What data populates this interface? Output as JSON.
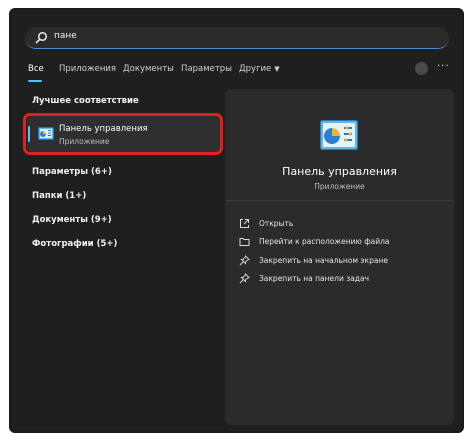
{
  "search": {
    "query": "пане"
  },
  "tabs": [
    {
      "label": "Все"
    },
    {
      "label": "Приложения"
    },
    {
      "label": "Документы"
    },
    {
      "label": "Параметры"
    },
    {
      "label": "Другие"
    }
  ],
  "left": {
    "best_match_title": "Лучшее соответствие",
    "best_match": {
      "name": "Панель управления",
      "type": "Приложение"
    },
    "categories": [
      {
        "label": "Параметры (6+)"
      },
      {
        "label": "Папки (1+)"
      },
      {
        "label": "Документы (9+)"
      },
      {
        "label": "Фотографии (5+)"
      }
    ]
  },
  "preview": {
    "title": "Панель управления",
    "type": "Приложение",
    "actions": [
      {
        "label": "Открыть",
        "icon": "open-icon"
      },
      {
        "label": "Перейти к расположению файла",
        "icon": "folder-icon"
      },
      {
        "label": "Закрепить на начальном экране",
        "icon": "pin-icon"
      },
      {
        "label": "Закрепить на панели задач",
        "icon": "pin-icon"
      }
    ]
  },
  "colors": {
    "accent": "#4cc2ff",
    "highlight": "#e0211e",
    "background": "#1f1f1f",
    "panel": "#2b2b2b"
  }
}
